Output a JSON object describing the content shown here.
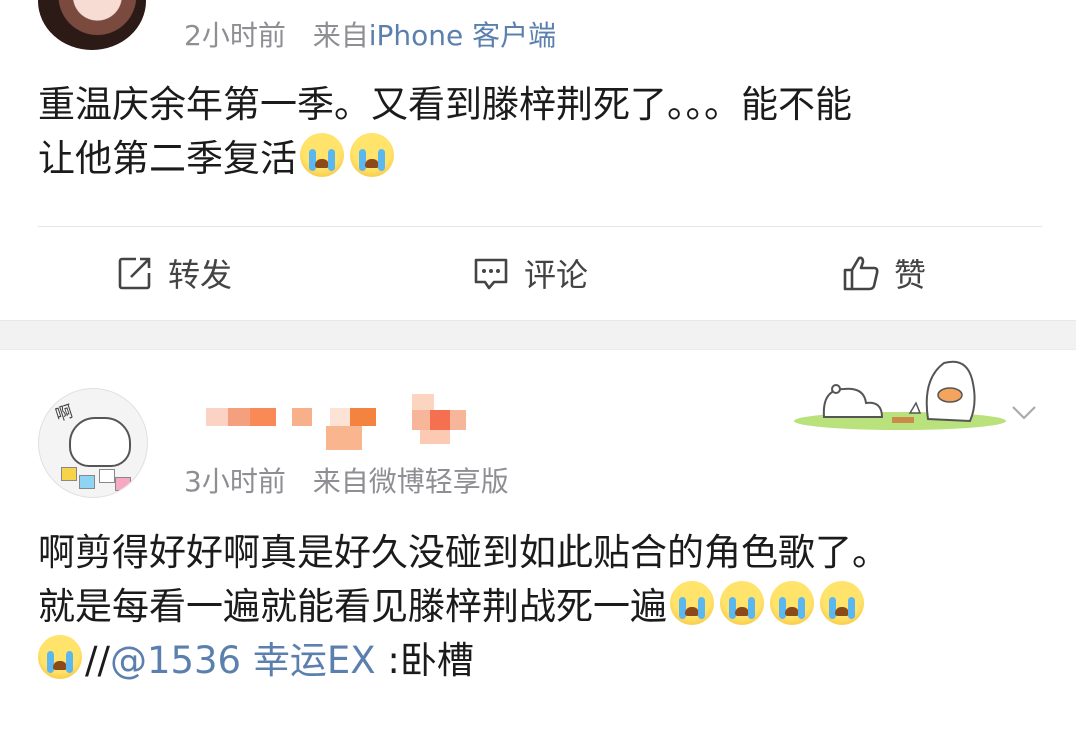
{
  "post1": {
    "time": "2小时前",
    "from_prefix": "来自",
    "source": "iPhone 客户端",
    "content_line1": "重温庆余年第一季。又看到滕梓荆死了。。。能不能",
    "content_line2": "让他第二季复活"
  },
  "actions": {
    "repost": "转发",
    "comment": "评论",
    "like": "赞"
  },
  "post2": {
    "time": "3小时前",
    "from_prefix": "来自",
    "source": "微博轻享版",
    "avatar_text": "啊",
    "content_line1": "啊剪得好好啊真是好久没碰到如此贴合的角色歌了。",
    "content_line2": "就是每看一遍就能看见滕梓荆战死一遍",
    "repost_sep": "//",
    "mention": "@1536 幸运EX",
    "repost_text": ":卧槽"
  },
  "icons": {
    "repost": "share-icon",
    "comment": "comment-icon",
    "like": "thumbs-up-icon",
    "more": "chevron-down-icon",
    "emoji": "crying-face-emoji"
  },
  "colors": {
    "link": "#5b80ad",
    "meta": "#8e8e93",
    "separator": "#f2f2f2"
  }
}
